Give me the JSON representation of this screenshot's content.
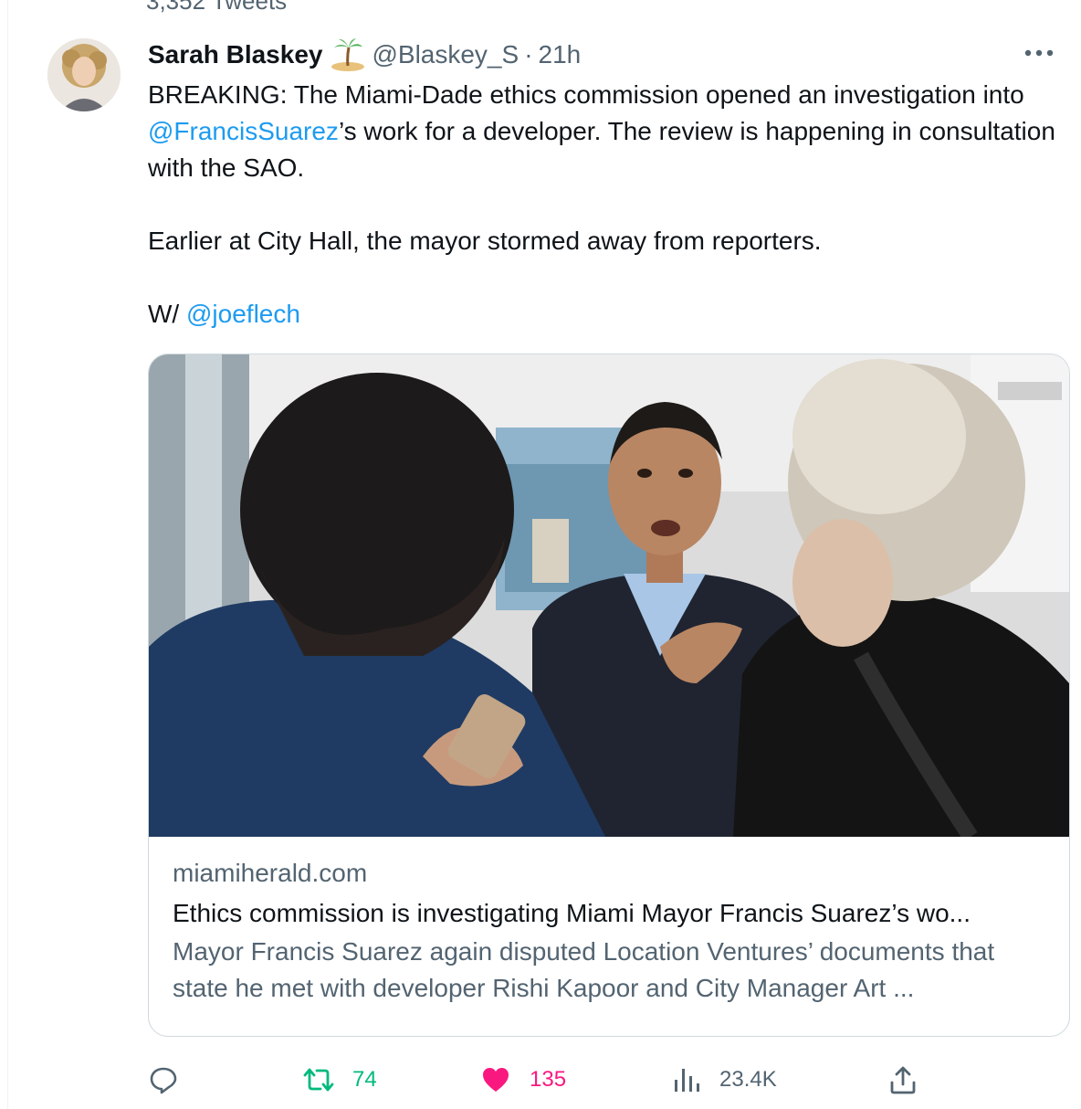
{
  "top_cut_text": "3,352 Tweets",
  "tweet": {
    "author_name": "Sarah Blaskey",
    "author_handle": "@Blaskey_S",
    "separator": "·",
    "timestamp": "21h",
    "text_line1_a": "BREAKING: The Miami-Dade ethics commission opened an investigation into ",
    "mention1": "@FrancisSuarez",
    "text_line1_b": "’s work for a developer. The review is happening in consultation with the SAO.",
    "text_line2": "Earlier at City Hall, the mayor stormed away from reporters.",
    "text_line3_prefix": "W/ ",
    "mention2": "@joeflech"
  },
  "card": {
    "domain": "miamiherald.com",
    "headline": "Ethics commission is investigating Miami Mayor Francis Suarez’s wo...",
    "description": "Mayor Francis Suarez again disputed Location Ventures’ documents that state he met with developer Rishi Kapoor and City Manager Art ..."
  },
  "actions": {
    "reply_count": "",
    "retweet_count": "74",
    "like_count": "135",
    "views_count": "23.4K"
  },
  "colors": {
    "text_primary": "#0f1419",
    "text_secondary": "#536471",
    "link_blue": "#1d9bf0",
    "retweet_green": "#00ba7c",
    "like_pink": "#f91880",
    "border": "#cfd9de"
  },
  "icons": {
    "author_emoji": "desert-island-icon",
    "more": "more-horizontal-icon",
    "reply": "reply-icon",
    "retweet": "retweet-icon",
    "like": "heart-icon",
    "views": "views-icon",
    "share": "share-icon"
  }
}
